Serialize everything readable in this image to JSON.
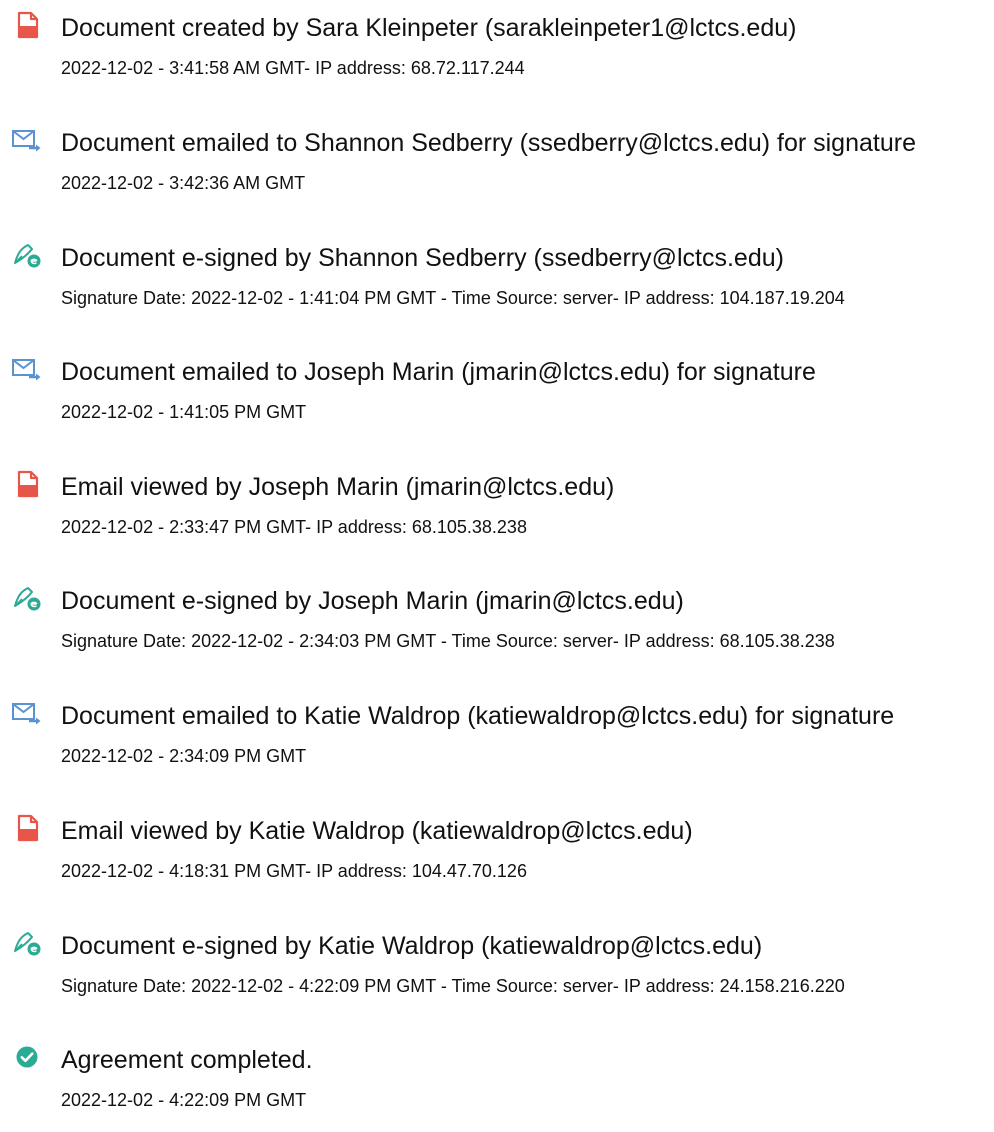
{
  "events": [
    {
      "icon": "document-created-icon",
      "title": "Document created by Sara Kleinpeter (sarakleinpeter1@lctcs.edu)",
      "detail": "2022-12-02 - 3:41:58 AM GMT- IP address: 68.72.117.244"
    },
    {
      "icon": "email-sent-icon",
      "title": "Document emailed to Shannon Sedberry (ssedberry@lctcs.edu) for signature",
      "detail": "2022-12-02 - 3:42:36 AM GMT"
    },
    {
      "icon": "e-signed-icon",
      "title": "Document e-signed by Shannon Sedberry (ssedberry@lctcs.edu)",
      "detail": "Signature Date: 2022-12-02 - 1:41:04 PM GMT - Time Source: server- IP address: 104.187.19.204"
    },
    {
      "icon": "email-sent-icon",
      "title": "Document emailed to Joseph Marin (jmarin@lctcs.edu) for signature",
      "detail": "2022-12-02 - 1:41:05 PM GMT"
    },
    {
      "icon": "document-viewed-icon",
      "title": "Email viewed by Joseph Marin (jmarin@lctcs.edu)",
      "detail": "2022-12-02 - 2:33:47 PM GMT- IP address: 68.105.38.238"
    },
    {
      "icon": "e-signed-icon",
      "title": "Document e-signed by Joseph Marin (jmarin@lctcs.edu)",
      "detail": "Signature Date: 2022-12-02 - 2:34:03 PM GMT - Time Source: server- IP address: 68.105.38.238"
    },
    {
      "icon": "email-sent-icon",
      "title": "Document emailed to Katie Waldrop (katiewaldrop@lctcs.edu) for signature",
      "detail": "2022-12-02 - 2:34:09 PM GMT"
    },
    {
      "icon": "document-viewed-icon",
      "title": "Email viewed by Katie Waldrop (katiewaldrop@lctcs.edu)",
      "detail": "2022-12-02 - 4:18:31 PM GMT- IP address: 104.47.70.126"
    },
    {
      "icon": "e-signed-icon",
      "title": "Document e-signed by Katie Waldrop (katiewaldrop@lctcs.edu)",
      "detail": "Signature Date: 2022-12-02 - 4:22:09 PM GMT - Time Source: server- IP address: 24.158.216.220"
    },
    {
      "icon": "agreement-completed-icon",
      "title": "Agreement completed.",
      "detail": "2022-12-02 - 4:22:09 PM GMT"
    }
  ],
  "colors": {
    "document_icon": "#e8564a",
    "email_icon": "#5b93cf",
    "signed_icon": "#2bab93",
    "completed_icon": "#2bab93",
    "text": "#111111"
  }
}
